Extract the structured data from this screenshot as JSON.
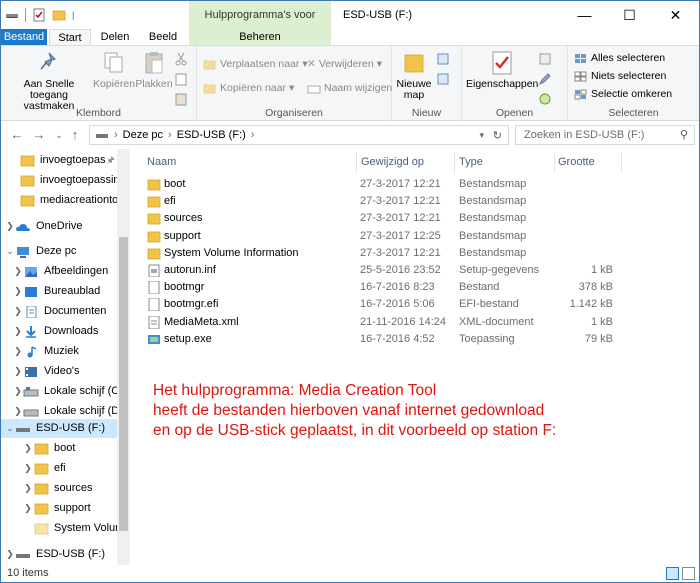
{
  "window": {
    "title": "ESD-USB (F:)",
    "context_tab_title": "Hulpprogramma's voor stations",
    "controls": [
      "minimize",
      "maximize",
      "close"
    ]
  },
  "ribbon_tabs": {
    "file": "Bestand",
    "start": "Start",
    "share": "Delen",
    "view": "Beeld",
    "manage": "Beheren"
  },
  "ribbon": {
    "clipboard": {
      "label": "Klembord",
      "pin": "Aan Snelle toegang vastmaken",
      "copy": "Kopiëren",
      "paste": "Plakken"
    },
    "organize": {
      "label": "Organiseren",
      "move_to": "Verplaatsen naar",
      "copy_to": "Kopiëren naar",
      "delete": "Verwijderen",
      "rename": "Naam wijzigen"
    },
    "new": {
      "label": "Nieuw",
      "new_folder": "Nieuwe map"
    },
    "open": {
      "label": "Openen",
      "properties": "Eigenschappen"
    },
    "select": {
      "label": "Selecteren",
      "select_all": "Alles selecteren",
      "select_none": "Niets selecteren",
      "invert": "Selectie omkeren"
    }
  },
  "address": {
    "crumbs": [
      "Deze pc",
      "ESD-USB (F:)"
    ],
    "search_placeholder": "Zoeken in ESD-USB (F:)"
  },
  "nav_tree": [
    {
      "label": "invoegtoepas",
      "icon": "folder-icon",
      "pinned": true
    },
    {
      "label": "invoegtoepassin",
      "icon": "folder-icon"
    },
    {
      "label": "mediacreationto",
      "icon": "folder-icon"
    },
    {
      "label": "OneDrive",
      "icon": "cloud-icon"
    },
    {
      "label": "Deze pc",
      "icon": "computer-icon"
    },
    {
      "label": "Afbeeldingen",
      "icon": "pictures-icon"
    },
    {
      "label": "Bureaublad",
      "icon": "desktop-icon"
    },
    {
      "label": "Documenten",
      "icon": "documents-icon"
    },
    {
      "label": "Downloads",
      "icon": "downloads-icon"
    },
    {
      "label": "Muziek",
      "icon": "music-icon"
    },
    {
      "label": "Video's",
      "icon": "videos-icon"
    },
    {
      "label": "Lokale schijf (C:)",
      "icon": "drive-icon"
    },
    {
      "label": "Lokale schijf (D:)",
      "icon": "drive-icon"
    },
    {
      "label": "ESD-USB (F:)",
      "icon": "usb-drive-icon"
    },
    {
      "label": "boot",
      "icon": "folder-icon"
    },
    {
      "label": "efi",
      "icon": "folder-icon"
    },
    {
      "label": "sources",
      "icon": "folder-icon"
    },
    {
      "label": "support",
      "icon": "folder-icon"
    },
    {
      "label": "System Volume",
      "icon": "folder-icon"
    },
    {
      "label": "ESD-USB (F:)",
      "icon": "usb-drive-icon"
    }
  ],
  "columns": {
    "name": "Naam",
    "date": "Gewijzigd op",
    "type": "Type",
    "size": "Grootte"
  },
  "files": [
    {
      "name": "boot",
      "date": "27-3-2017 12:21",
      "type": "Bestandsmap",
      "size": "",
      "icon": "folder-icon"
    },
    {
      "name": "efi",
      "date": "27-3-2017 12:21",
      "type": "Bestandsmap",
      "size": "",
      "icon": "folder-icon"
    },
    {
      "name": "sources",
      "date": "27-3-2017 12:21",
      "type": "Bestandsmap",
      "size": "",
      "icon": "folder-icon"
    },
    {
      "name": "support",
      "date": "27-3-2017 12:25",
      "type": "Bestandsmap",
      "size": "",
      "icon": "folder-icon"
    },
    {
      "name": "System Volume Information",
      "date": "27-3-2017 12:21",
      "type": "Bestandsmap",
      "size": "",
      "icon": "folder-icon"
    },
    {
      "name": "autorun.inf",
      "date": "25-5-2016 23:52",
      "type": "Setup-gegevens",
      "size": "1 kB",
      "icon": "setup-info-icon"
    },
    {
      "name": "bootmgr",
      "date": "16-7-2016 8:23",
      "type": "Bestand",
      "size": "378 kB",
      "icon": "file-icon"
    },
    {
      "name": "bootmgr.efi",
      "date": "16-7-2016 5:06",
      "type": "EFI-bestand",
      "size": "1.142 kB",
      "icon": "file-icon"
    },
    {
      "name": "MediaMeta.xml",
      "date": "21-11-2016 14:24",
      "type": "XML-document",
      "size": "1 kB",
      "icon": "xml-icon"
    },
    {
      "name": "setup.exe",
      "date": "16-7-2016 4:52",
      "type": "Toepassing",
      "size": "79 kB",
      "icon": "setup-exe-icon"
    }
  ],
  "note": [
    "Het hulpprogramma: Media Creation Tool",
    "heeft de bestanden hierboven vanaf internet gedownload",
    "en op de USB-stick geplaatst, in dit voorbeeld op station F:"
  ],
  "status": {
    "count": "10 items"
  },
  "colors": {
    "accent": "#1979ca",
    "context_tab": "#dcefd0",
    "note": "#e0140e",
    "selection": "#cce8ff"
  }
}
